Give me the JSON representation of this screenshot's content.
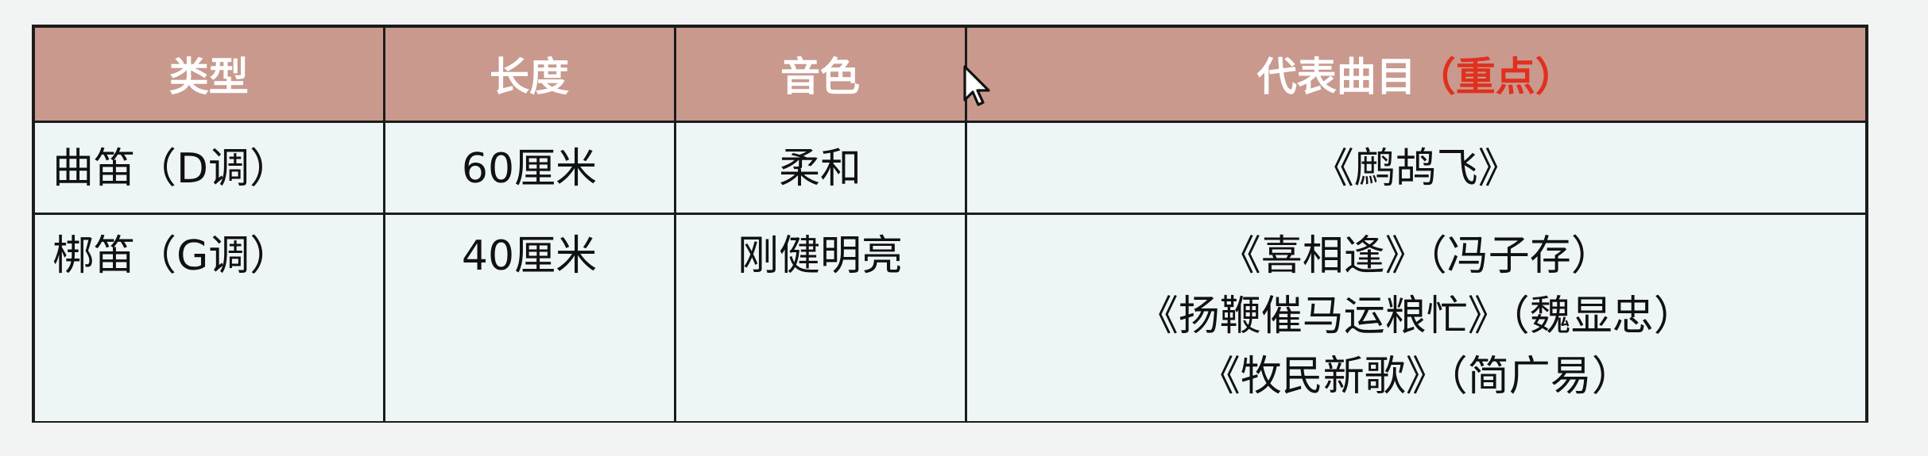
{
  "table": {
    "headers": {
      "type": "类型",
      "length": "长度",
      "timbre": "音色",
      "pieces": "代表曲目",
      "pieces_highlight": "（重点）"
    },
    "rows": [
      {
        "type": "曲笛（D调）",
        "length": "60厘米",
        "timbre": "柔和",
        "pieces": [
          "《鹧鸪飞》"
        ]
      },
      {
        "type": "梆笛（G调）",
        "length": "40厘米",
        "timbre": "刚健明亮",
        "pieces": [
          "《喜相逢》（冯子存）",
          "《扬鞭催马运粮忙》（魏显忠）",
          "《牧民新歌》（简广易）"
        ]
      }
    ]
  },
  "colors": {
    "header_bg": "#c9998e",
    "header_text": "#ffffff",
    "highlight": "#e0301e",
    "cell_bg": "#eef5f7",
    "border": "#1c1c1c"
  },
  "icons": {
    "cursor": "mouse-pointer-icon"
  }
}
